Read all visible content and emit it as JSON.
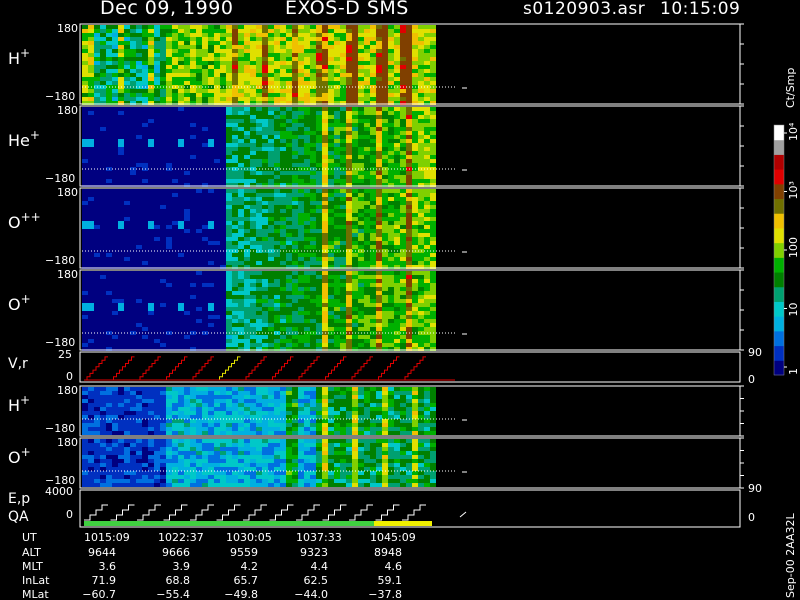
{
  "header": {
    "date": "Dec 09, 1990",
    "instrument": "EXOS-D SMS",
    "file": "s0120903.asr",
    "time": "10:15:09"
  },
  "panels": [
    {
      "id": "h-plus-1",
      "species": "H",
      "charge": "+",
      "ytop": "180",
      "ybot": "−180"
    },
    {
      "id": "he-plus",
      "species": "He",
      "charge": "+",
      "ytop": "180",
      "ybot": "−180"
    },
    {
      "id": "o-plusplus",
      "species": "O",
      "charge": "++",
      "ytop": "180",
      "ybot": "−180"
    },
    {
      "id": "o-plus-1",
      "species": "O",
      "charge": "+",
      "ytop": "180",
      "ybot": "−180"
    },
    {
      "id": "h-plus-2",
      "species": "H",
      "charge": "+",
      "ytop": "180",
      "ybot": "−180"
    },
    {
      "id": "o-plus-2",
      "species": "O",
      "charge": "+",
      "ytop": "180",
      "ybot": "−180"
    }
  ],
  "vr_panel": {
    "label": "V,r",
    "ytop": "25",
    "ybot": "0",
    "rtop": "90",
    "rbot": "0"
  },
  "ep_panel": {
    "label1": "E,p",
    "label2": "QA",
    "ytop": "4000",
    "ybot": "0",
    "rtop": "90",
    "rbot": "0"
  },
  "colorbar": {
    "unit": "Ct/Smp",
    "ticks": [
      {
        "label": "10⁴",
        "value": 10000
      },
      {
        "label": "10³",
        "value": 1000
      },
      {
        "label": "100",
        "value": 100
      },
      {
        "label": "10",
        "value": 10
      },
      {
        "label": "1",
        "value": 1
      }
    ],
    "colors": [
      "#000080",
      "#0030c0",
      "#0070e0",
      "#00b0e0",
      "#00c8c8",
      "#00a070",
      "#008000",
      "#00b000",
      "#80d000",
      "#e0e000",
      "#f0c000",
      "#707000",
      "#804000",
      "#e00000",
      "#b00000",
      "#a0a0a0",
      "#ffffff"
    ]
  },
  "version_label": "Sep-00  2AA32L",
  "ephemeris": {
    "row_labels": [
      "UT",
      "ALT",
      "MLT",
      "InLat",
      "MLat"
    ],
    "columns": [
      {
        "ut": "1015:09",
        "alt": "9644",
        "mlt": "3.6",
        "inlat": "71.9",
        "mlat": "−60.7"
      },
      {
        "ut": "1022:37",
        "alt": "9666",
        "mlt": "3.9",
        "inlat": "68.8",
        "mlat": "−55.4"
      },
      {
        "ut": "1030:05",
        "alt": "9559",
        "mlt": "4.2",
        "inlat": "65.7",
        "mlat": "−49.8"
      },
      {
        "ut": "1037:33",
        "alt": "9323",
        "mlt": "4.4",
        "inlat": "62.5",
        "mlat": "−44.0"
      },
      {
        "ut": "1045:09",
        "alt": "8948",
        "mlt": "4.6",
        "inlat": "59.1",
        "mlat": "−37.8"
      }
    ]
  },
  "chart_data": {
    "type": "heatmap",
    "title": "Dec 09, 1990   EXOS-D SMS",
    "subtitle": "s0120903.asr  10:15:09",
    "xlabel": "UT",
    "x_ticks": [
      "1015:09",
      "1022:37",
      "1030:05",
      "1037:33",
      "1045:09"
    ],
    "ylim": [
      -180,
      180
    ],
    "colorbar_label": "Ct/Smp",
    "colorbar_scale": "log",
    "colorbar_range": [
      1,
      10000
    ],
    "series": [
      {
        "name": "H+",
        "peak_value": 1000
      },
      {
        "name": "He+",
        "peak_value": 300
      },
      {
        "name": "O++",
        "peak_value": 300
      },
      {
        "name": "O+",
        "peak_value": 300
      },
      {
        "name": "H+",
        "peak_value": 30
      },
      {
        "name": "O+",
        "peak_value": 20
      }
    ]
  }
}
